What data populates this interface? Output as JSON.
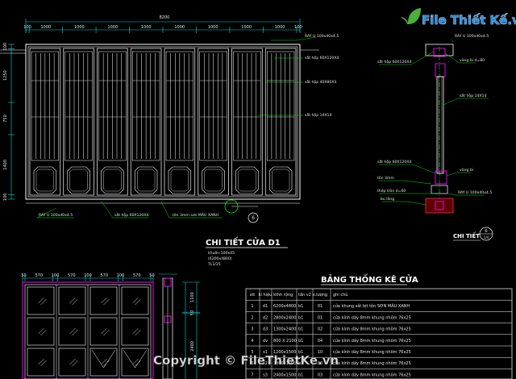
{
  "logo": {
    "text": "File Thiết Kế.vn",
    "icon": "leaf-logo-icon"
  },
  "watermark": {
    "text": "Copyright © FileThietKe.vn"
  },
  "elevation": {
    "overall_dim": "8200",
    "top_dims": [
      "100",
      "1000",
      "1000",
      "1000",
      "1000",
      "1000",
      "1000",
      "1000",
      "1000",
      "100"
    ],
    "left_dims": [
      "100",
      "1250",
      "750",
      "1400",
      "100"
    ],
    "labels": [
      "RAY U 100x40x4.5",
      "sắt hộp 60X120X4",
      "sắt hộp 40X80X3",
      "sắt hộp 14X14",
      "RAY U 100x40x4.5",
      "sắt hộp 60X120X4",
      "tôn 3mm sơn MÀU XANH"
    ],
    "marker": "6",
    "caption": "CHI TIẾT CỬA D1",
    "notes": [
      "khuôn 100x45",
      "(6200x4800)",
      "TL1/25"
    ]
  },
  "section": {
    "labels": [
      "RAY U 100x40x4.5",
      "sắt hộp 60X120X4",
      "vòng bi d=80",
      "sắt hộp 14X14",
      "sắt hộp 60X120X4",
      "vòng bi",
      "tôn 3mm",
      "thép tròn d=60",
      "RAY U 100x40x4.5",
      "bu lông"
    ],
    "caption": "CHI TIẾT",
    "marker": "6",
    "marker_sub": "1/4"
  },
  "small_door": {
    "top_dims": [
      "50",
      "570",
      "100",
      "570",
      "100",
      "570",
      "100",
      "570",
      "50"
    ],
    "right_dims": [
      "1100",
      "50",
      "2400"
    ]
  },
  "table": {
    "title": "BẢNG THỐNG KÊ CỬA",
    "headers": [
      "stt",
      "kí hiệu",
      "kthh rộng",
      "tấn v2",
      "s.lượng",
      "ghi chú"
    ],
    "rows": [
      [
        "1",
        "d1",
        "6200x4800",
        "b1",
        "01",
        "cửa khung sắt bịt tôn  SƠN MÀU XANH"
      ],
      [
        "2",
        "d2",
        "2800x2400",
        "b1",
        "01",
        "cửa kính dày 8mm khung nhôm 76x25"
      ],
      [
        "3",
        "d3",
        "1300x2400",
        "b1",
        "02",
        "cửa kính dày 8mm khung nhôm 76x25"
      ],
      [
        "4",
        "dv",
        "800 X 2100",
        "b1",
        "04",
        "cửa kính dày 8mm khung nhôm 76x25"
      ],
      [
        "5",
        "s1",
        "1200x1500",
        "b1",
        "10",
        "cửa kính dày 8mm khung nhôm 76x25"
      ],
      [
        "6",
        "s2",
        "1800x1500",
        "b1",
        "06",
        "cửa kính dày 8mm khung nhôm 76x25"
      ],
      [
        "7",
        "s3",
        "2400x1500",
        "b1",
        "03",
        "cửa kính dày 8mm khung nhôm 76x25"
      ]
    ]
  },
  "colors": {
    "background": "#000000",
    "frame": "#ffffff",
    "dimension": "#00d8d8",
    "leader": "#00e000",
    "accent": "#ff00ff",
    "logo_blue": "#2b8fe0",
    "logo_green": "#4caf3a"
  }
}
